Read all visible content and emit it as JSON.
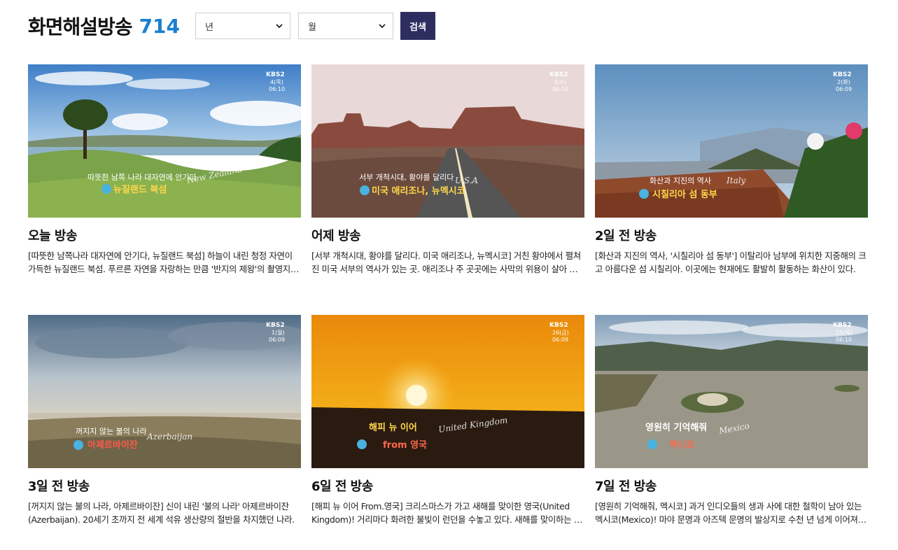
{
  "header": {
    "title": "화면해설방송",
    "count": "714",
    "year_select": "년",
    "month_select": "월",
    "search_label": "검색"
  },
  "cards": [
    {
      "title": "오늘 방송",
      "desc": "[따뜻한 남쪽나라 대자연에 안기다, 뉴질랜드 북섬] 하늘이 내린 청정 자연이 가득한 뉴질랜드 북섬. 푸르른 자연을 자랑하는 만큼 '반지의 제왕'의 촬영지로도 유명한 곳이다.",
      "thumb": {
        "caption1": "따뜻한 남쪽 나라 대자연에 안기다",
        "caption2": "뉴질랜드 북섬",
        "script": "New Zealand",
        "kbs": "KBS2",
        "date": "4(목)",
        "time": "06:10"
      }
    },
    {
      "title": "어제 방송",
      "desc": "[서부 개척시대, 황야를 달리다. 미국 애리조나, 뉴멕시코] 거친 황야에서 펼쳐진 미국 서부의 역사가 있는 곳. 애리조나 주 곳곳에는 사막의 위용이 살아 숨쉰다.",
      "thumb": {
        "caption1": "서부 개척시대, 황야를 달리다",
        "caption2": "미국 애리조나, 뉴멕시코",
        "script": "U.S.A",
        "kbs": "KBS2",
        "date": "3(수)",
        "time": "06:10"
      }
    },
    {
      "title": "2일 전 방송",
      "desc": "[화산과 지진의 역사, '시칠리아 섬 동부'] 이탈리아 남부에 위치한 지중해의 크고 아름다운 섬 시칠리아. 이곳에는 현재에도 활발히 활동하는 화산이 있다.",
      "thumb": {
        "caption1": "화산과 지진의 역사",
        "caption2": "시칠리아 섬 동부",
        "script": "Italy",
        "kbs": "KBS2",
        "date": "2(화)",
        "time": "06:09"
      }
    },
    {
      "title": "3일 전 방송",
      "desc": "[꺼지지 않는 불의 나라, 아제르바이잔] 신이 내린 '불의 나라' 아제르바이잔(Azerbaijan). 20세기 초까지 전 세계 석유 생산량의 절반을 차지했던 나라.",
      "thumb": {
        "caption1": "꺼지지 않는 불의 나라",
        "caption2": "아제르바이잔",
        "script": "Azerbaijan",
        "kbs": "KBS2",
        "date": "1(월)",
        "time": "06:09"
      }
    },
    {
      "title": "6일 전 방송",
      "desc": "[해피 뉴 이어 From.영국] 크리스마스가 가고 새해를 맞이한 영국(United Kingdom)! 거리마다 화려한 불빛이 런던을 수놓고 있다. 새해를 맞이하는 사람들.",
      "thumb": {
        "caption1": "해피 뉴 이어",
        "caption2": "from 영국",
        "script": "United Kingdom",
        "kbs": "KBS2",
        "date": "26(금)",
        "time": "06:09"
      }
    },
    {
      "title": "7일 전 방송",
      "desc": "[영원히 기억해줘, 멕시코] 과거 인디오들의 생과 사에 대한 철학이 남아 있는 멕시코(Mexico)! 마야 문명과 아즈텍 문명의 발상지로 수천 년 넘게 이어져 온 곳.",
      "thumb": {
        "caption1": "영원히 기억해줘",
        "caption2": "멕시코",
        "script": "Mexico",
        "kbs": "KBS2",
        "date": "25(목)",
        "time": "06:10"
      }
    }
  ]
}
